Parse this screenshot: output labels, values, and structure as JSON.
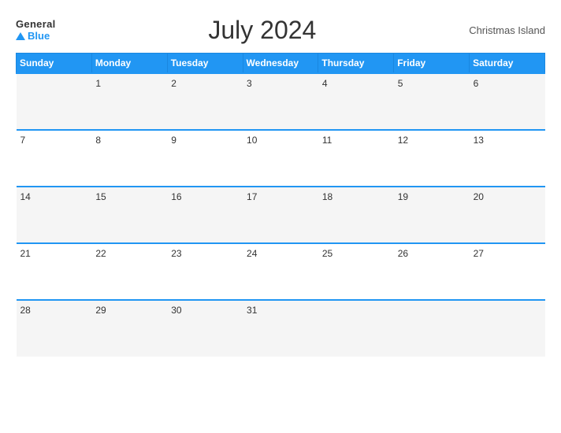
{
  "header": {
    "logo_general": "General",
    "logo_blue": "Blue",
    "title": "July 2024",
    "location": "Christmas Island"
  },
  "calendar": {
    "days_of_week": [
      "Sunday",
      "Monday",
      "Tuesday",
      "Wednesday",
      "Thursday",
      "Friday",
      "Saturday"
    ],
    "weeks": [
      [
        "",
        "1",
        "2",
        "3",
        "4",
        "5",
        "6"
      ],
      [
        "7",
        "8",
        "9",
        "10",
        "11",
        "12",
        "13"
      ],
      [
        "14",
        "15",
        "16",
        "17",
        "18",
        "19",
        "20"
      ],
      [
        "21",
        "22",
        "23",
        "24",
        "25",
        "26",
        "27"
      ],
      [
        "28",
        "29",
        "30",
        "31",
        "",
        "",
        ""
      ]
    ]
  }
}
